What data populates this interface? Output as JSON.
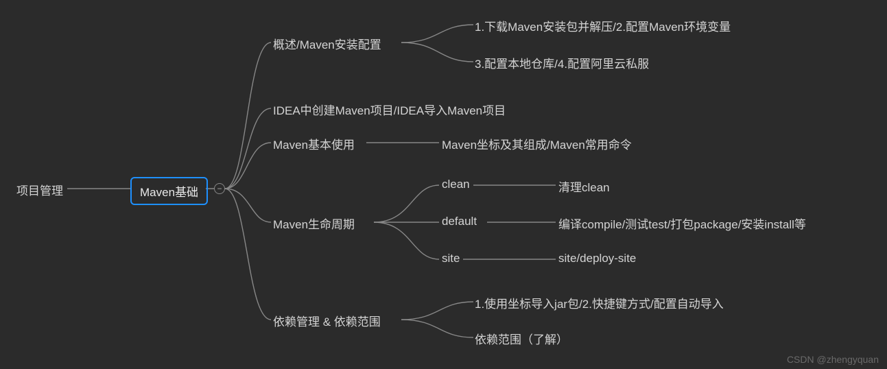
{
  "root_left": "项目管理",
  "root_main": "Maven基础",
  "branches": {
    "b1": "概述/Maven安装配置",
    "b1_c1": "1.下载Maven安装包并解压/2.配置Maven环境变量",
    "b1_c2": "3.配置本地仓库/4.配置阿里云私服",
    "b2": "IDEA中创建Maven项目/IDEA导入Maven项目",
    "b3": "Maven基本使用",
    "b3_c1": "Maven坐标及其组成/Maven常用命令",
    "b4": "Maven生命周期",
    "b4_c1": "clean",
    "b4_c1_d1": "清理clean",
    "b4_c2": "default",
    "b4_c2_d1": "编译compile/测试test/打包package/安装install等",
    "b4_c3": "site",
    "b4_c3_d1": "site/deploy-site",
    "b5": "依赖管理 & 依赖范围",
    "b5_c1": "1.使用坐标导入jar包/2.快捷键方式/配置自动导入",
    "b5_c2": "依赖范围（了解）"
  },
  "watermark": "CSDN @zhengyquan",
  "collapse_symbol": "−"
}
